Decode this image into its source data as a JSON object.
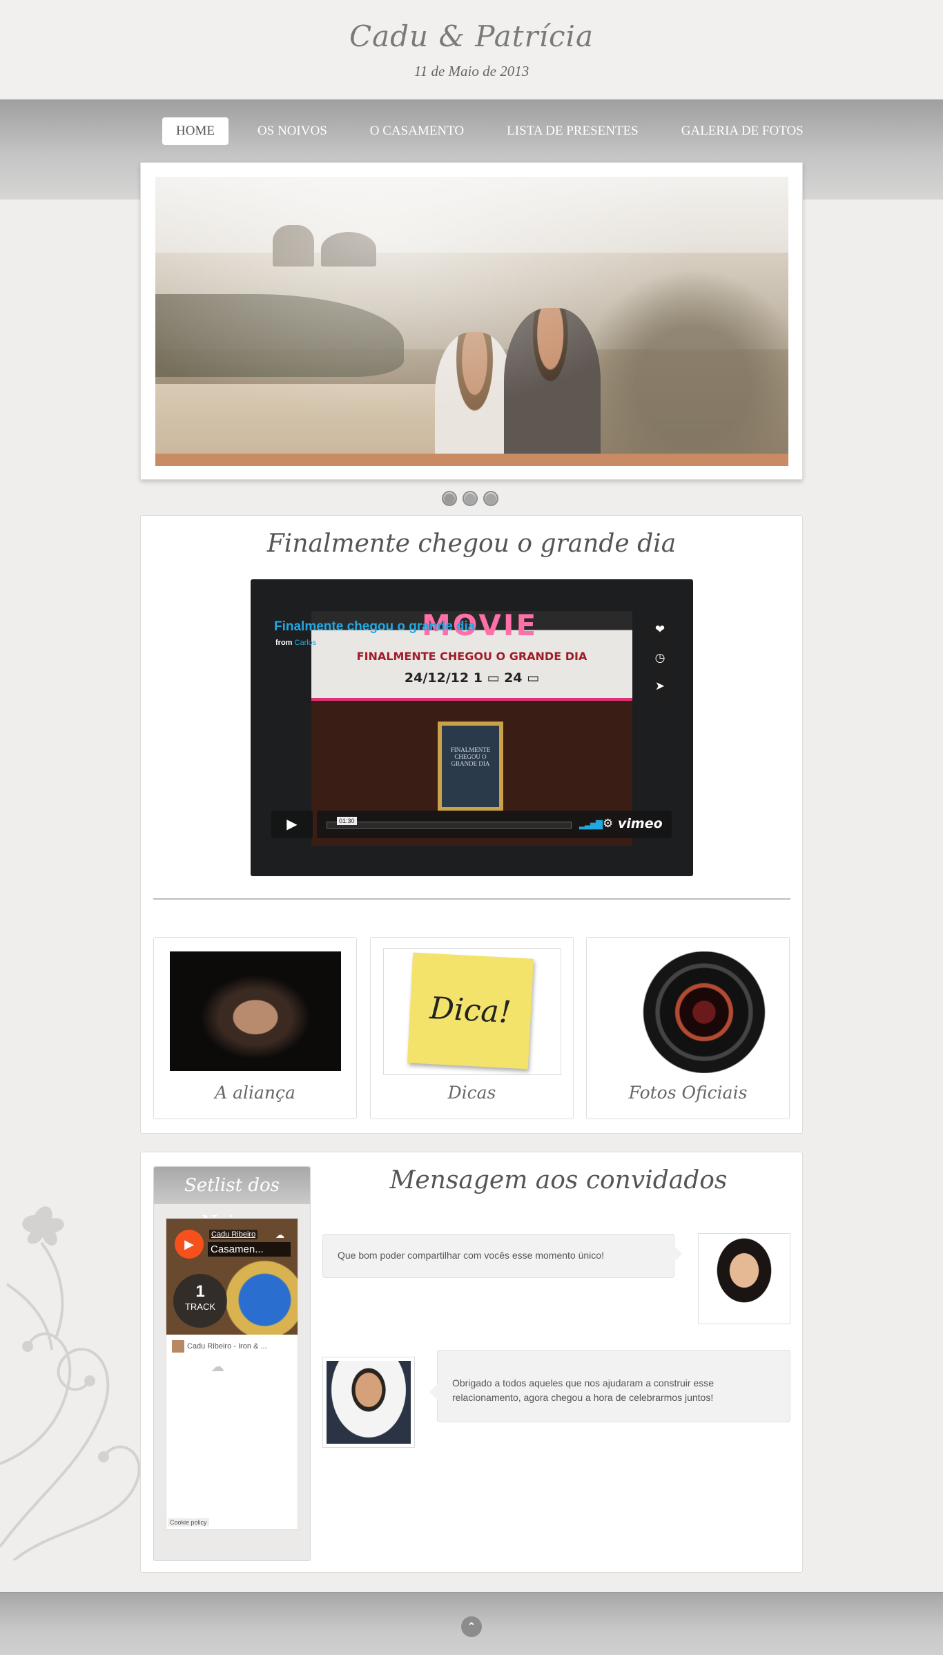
{
  "header": {
    "title": "Cadu & Patrícia",
    "date": "11 de Maio de 2013"
  },
  "nav": {
    "items": [
      {
        "label": "HOME"
      },
      {
        "label": "OS NOIVOS"
      },
      {
        "label": "O CASAMENTO"
      },
      {
        "label": "LISTA DE PRESENTES"
      },
      {
        "label": "GALERIA DE FOTOS"
      }
    ],
    "active_index": 0
  },
  "slider": {
    "slide_count": 3,
    "active_slide": 1
  },
  "feature": {
    "title": "Finalmente chegou o grande dia",
    "video": {
      "title": "Finalmente chegou o grande dia",
      "from_label": "from",
      "author": "Carlos",
      "marquee_word": "MOVIE",
      "marquee_line1": "FINALMENTE CHEGOU O GRANDE DIA",
      "marquee_line2": "24/12/12   1 ▭ 24 ▭",
      "poster_text": "FINALMENTE CHEGOU O GRANDE DIA",
      "time": "01:30",
      "brand": "vimeo"
    }
  },
  "cards": [
    {
      "label": "A aliança",
      "icon": "rings-hands-photo"
    },
    {
      "label": "Dicas",
      "image_text": "Dica!"
    },
    {
      "label": "Fotos Oficiais",
      "icon": "camera-lens-photo"
    }
  ],
  "setlist": {
    "title": "Setlist dos Noivos",
    "user": "Cadu Ribeiro",
    "track": "Casamen...",
    "track_count": "1",
    "track_label": "TRACK",
    "row_text": "Cadu Ribeiro - Iron & ...",
    "cookie": "Cookie policy"
  },
  "messages": {
    "title": "Mensagem aos convidados",
    "items": [
      {
        "text": "Que bom poder compartilhar com vocês esse momento único!"
      },
      {
        "text": "Obrigado a todos aqueles que nos ajudaram a construir esse relacionamento, agora chegou a hora de celebrarmos juntos!"
      }
    ]
  },
  "colors": {
    "accent_blue": "#22a7e0",
    "nav_band": "#a9a9a9",
    "soundcloud": "#f6511d"
  }
}
